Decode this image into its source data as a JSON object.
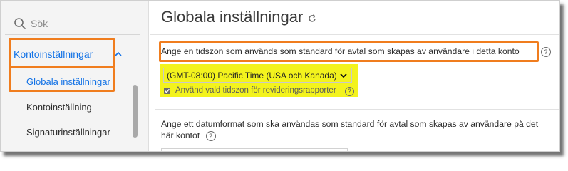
{
  "sidebar": {
    "search_placeholder": "Sök",
    "section": "Kontoinställningar",
    "active_item": "Globala inställningar",
    "items": [
      "Kontoinställning",
      "Signaturinställningar"
    ]
  },
  "main": {
    "title": "Globala inställningar",
    "timezone": {
      "question": "Ange en tidszon som används som standard för avtal som skapas av användare i detta konto",
      "selected": "(GMT-08:00) Pacific Time (USA och Kanada)",
      "checkbox_label": "Använd vald tidszon för revideringsrapporter",
      "checkbox_checked": true
    },
    "dateformat": {
      "question_line1": "Ange ett datumformat som ska användas som standard för avtal som skapas av användare på det",
      "question_line2": "här kontot"
    },
    "help_glyph": "?"
  },
  "colors": {
    "accent": "#1473e6",
    "highlight_orange": "#f07d1e",
    "highlight_yellow": "#f3f31d"
  }
}
